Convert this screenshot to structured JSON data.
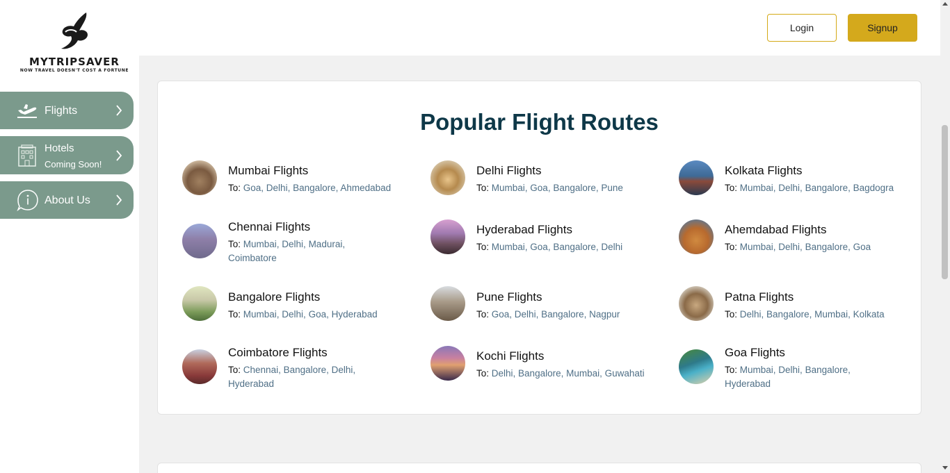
{
  "brand": {
    "name": "MYTRIPSAVER",
    "tagline": "NOW TRAVEL DOESN'T COST A FORTUNE"
  },
  "nav": {
    "flights": "Flights",
    "hotels": "Hotels",
    "hotels_sub": "Coming Soon!",
    "about": "About Us"
  },
  "header": {
    "login": "Login",
    "signup": "Signup"
  },
  "section": {
    "title": "Popular Flight Routes",
    "to_label": "To:"
  },
  "routes": [
    {
      "title": "Mumbai Flights",
      "to": "Goa, Delhi, Bangalore, Ahmedabad"
    },
    {
      "title": "Delhi Flights",
      "to": "Mumbai, Goa, Bangalore, Pune"
    },
    {
      "title": "Kolkata Flights",
      "to": "Mumbai, Delhi, Bangalore, Bagdogra"
    },
    {
      "title": "Chennai Flights",
      "to": "Mumbai, Delhi, Madurai, Coimbatore"
    },
    {
      "title": "Hyderabad Flights",
      "to": "Mumbai, Goa, Bangalore, Delhi"
    },
    {
      "title": "Ahemdabad Flights",
      "to": "Mumbai, Delhi, Bangalore, Goa"
    },
    {
      "title": "Bangalore Flights",
      "to": "Mumbai, Delhi, Goa, Hyderabad"
    },
    {
      "title": "Pune Flights",
      "to": "Goa, Delhi, Bangalore, Nagpur"
    },
    {
      "title": "Patna Flights",
      "to": "Delhi, Bangalore, Mumbai, Kolkata"
    },
    {
      "title": "Coimbatore Flights",
      "to": "Chennai, Bangalore, Delhi, Hyderabad"
    },
    {
      "title": "Kochi Flights",
      "to": "Delhi, Bangalore, Mumbai, Guwahati"
    },
    {
      "title": "Goa Flights",
      "to": "Mumbai, Delhi, Bangalore, Hyderabad"
    }
  ],
  "colors": {
    "nav_bg": "#7b9a8c",
    "accent_gold": "#d4a91c",
    "title": "#0e3848",
    "destination_link": "#4f6f86"
  }
}
